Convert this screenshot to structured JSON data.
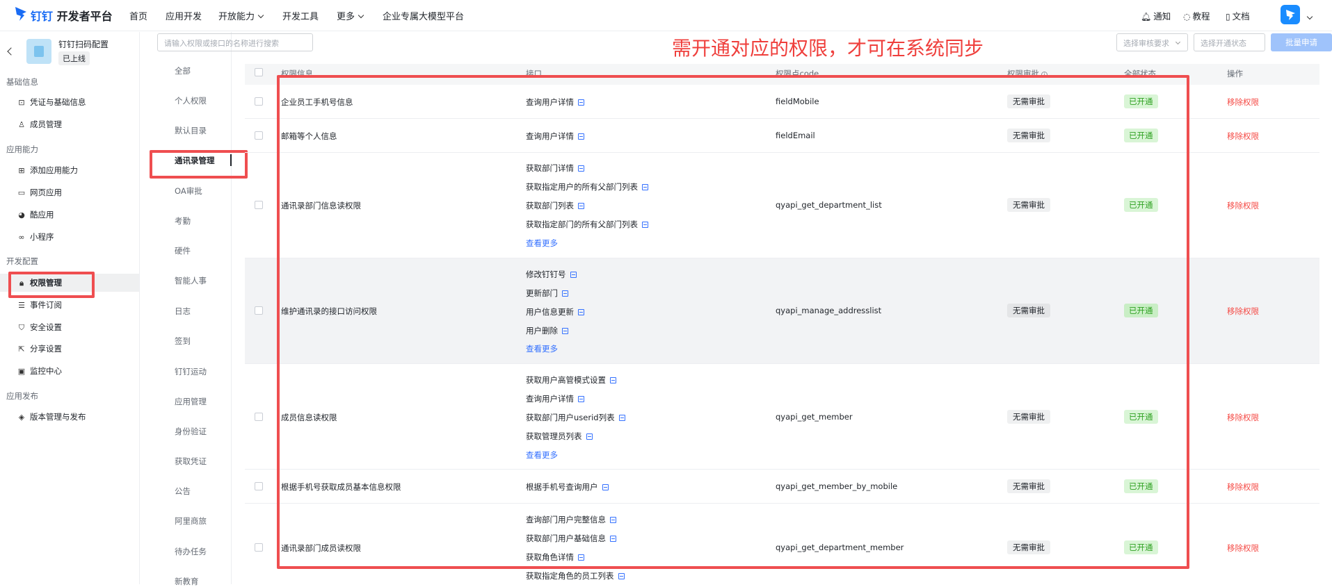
{
  "topbar": {
    "brand": "钉钉",
    "platform": "开发者平台",
    "nav": [
      "首页",
      "应用开发",
      "开放能力",
      "开发工具",
      "更多",
      "企业专属大模型平台"
    ],
    "notify": "通知",
    "tutorial": "教程",
    "docs": "文档"
  },
  "app": {
    "name": "钉钉扫码配置",
    "status": "已上线"
  },
  "sidebar": {
    "sections": [
      "基础信息",
      "应用能力",
      "开发配置",
      "应用发布"
    ],
    "items": [
      {
        "label": "凭证与基础信息",
        "icon": "credential-icon"
      },
      {
        "label": "成员管理",
        "icon": "user-icon"
      },
      {
        "label": "添加应用能力",
        "icon": "grid-plus-icon"
      },
      {
        "label": "网页应用",
        "icon": "browser-icon"
      },
      {
        "label": "酷应用",
        "icon": "cool-app-icon"
      },
      {
        "label": "小程序",
        "icon": "link-icon"
      },
      {
        "label": "权限管理",
        "icon": "lock-icon"
      },
      {
        "label": "事件订阅",
        "icon": "event-icon"
      },
      {
        "label": "安全设置",
        "icon": "shield-icon"
      },
      {
        "label": "分享设置",
        "icon": "share-icon"
      },
      {
        "label": "监控中心",
        "icon": "monitor-icon"
      },
      {
        "label": "版本管理与发布",
        "icon": "layers-icon"
      }
    ]
  },
  "search": {
    "placeholder": "请输入权限或接口的名称进行搜索"
  },
  "categories": [
    "全部",
    "个人权限",
    "默认目录",
    "通讯录管理",
    "OA审批",
    "考勤",
    "硬件",
    "智能人事",
    "日志",
    "签到",
    "钉钉运动",
    "应用管理",
    "身份验证",
    "获取凭证",
    "公告",
    "阿里商旅",
    "待办任务",
    "新教育"
  ],
  "filters": {
    "review": "选择审核要求",
    "status": "选择开通状态",
    "batch": "批量申请"
  },
  "annotation": "需开通对应的权限，才可在系统同步",
  "table": {
    "headers": [
      "权限信息",
      "接口",
      "权限点code",
      "权限审批",
      "全部状态",
      "操作"
    ],
    "more_label": "查看更多",
    "rows": [
      {
        "name": "企业员工手机号信息",
        "apis": [
          "查询用户详情"
        ],
        "code": "fieldMobile",
        "approval": "无需审批",
        "status": "已开通",
        "action": "移除权限"
      },
      {
        "name": "邮箱等个人信息",
        "apis": [
          "查询用户详情"
        ],
        "code": "fieldEmail",
        "approval": "无需审批",
        "status": "已开通",
        "action": "移除权限"
      },
      {
        "name": "通讯录部门信息读权限",
        "apis": [
          "获取部门详情",
          "获取指定用户的所有父部门列表",
          "获取部门列表",
          "获取指定部门的所有父部门列表"
        ],
        "code": "qyapi_get_department_list",
        "approval": "无需审批",
        "status": "已开通",
        "action": "移除权限"
      },
      {
        "name": "维护通讯录的接口访问权限",
        "apis": [
          "修改钉钉号",
          "更新部门",
          "用户信息更新",
          "用户删除"
        ],
        "code": "qyapi_manage_addresslist",
        "approval": "无需审批",
        "status": "已开通",
        "action": "移除权限"
      },
      {
        "name": "成员信息读权限",
        "apis": [
          "获取用户高管模式设置",
          "查询用户详情",
          "获取部门用户userid列表",
          "获取管理员列表"
        ],
        "code": "qyapi_get_member",
        "approval": "无需审批",
        "status": "已开通",
        "action": "移除权限"
      },
      {
        "name": "根据手机号获取成员基本信息权限",
        "apis": [
          "根据手机号查询用户"
        ],
        "code": "qyapi_get_member_by_mobile",
        "approval": "无需审批",
        "status": "已开通",
        "action": "移除权限"
      },
      {
        "name": "通讯录部门成员读权限",
        "apis": [
          "查询部门用户完整信息",
          "获取部门用户基础信息",
          "获取角色详情",
          "获取指定角色的员工列表"
        ],
        "code": "qyapi_get_department_member",
        "approval": "无需审批",
        "status": "已开通",
        "action": "移除权限"
      }
    ]
  }
}
